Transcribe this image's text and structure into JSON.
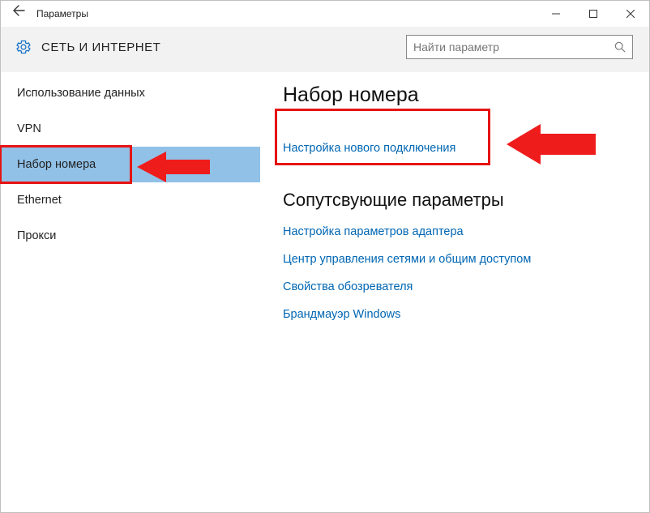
{
  "window_title": "Параметры",
  "section_title": "СЕТЬ И ИНТЕРНЕТ",
  "search_placeholder": "Найти параметр",
  "sidebar": {
    "items": [
      {
        "label": "Использование данных",
        "selected": false
      },
      {
        "label": "VPN",
        "selected": false
      },
      {
        "label": "Набор номера",
        "selected": true
      },
      {
        "label": "Ethernet",
        "selected": false
      },
      {
        "label": "Прокси",
        "selected": false
      }
    ]
  },
  "main": {
    "heading": "Набор номера",
    "primary_link": "Настройка нового подключения",
    "related_heading": "Сопутсвующие параметры",
    "related_links": [
      "Настройка параметров адаптера",
      "Центр управления сетями и общим доступом",
      "Свойства обозревателя",
      "Брандмауэр Windows"
    ]
  }
}
